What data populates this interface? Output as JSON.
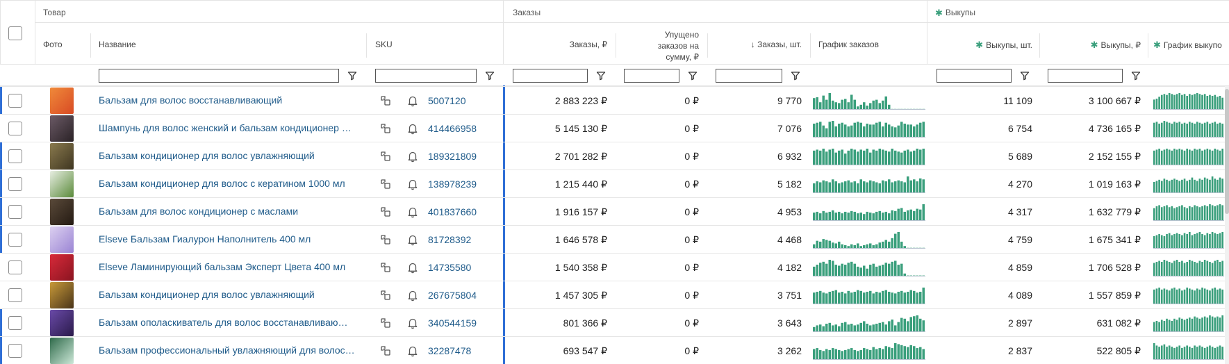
{
  "groups": {
    "product": "Товар",
    "orders": "Заказы",
    "buyouts": "Выкупы"
  },
  "columns": {
    "photo": "Фото",
    "name": "Название",
    "sku": "SKU",
    "orders_rub": "Заказы, ₽",
    "lost_l1": "Упущено",
    "lost_l2": "заказов на",
    "lost_l3": "сумму, ₽",
    "orders_pcs": "↓ Заказы, шт.",
    "orders_chart": "График заказов",
    "buyouts_pcs": "Выкупы, шт.",
    "buyouts_rub": "Выкупы, ₽",
    "buyouts_chart": "График выкупо"
  },
  "colors": {
    "accent": "#2f6fd6",
    "bars": "#3a9f7c",
    "link": "#1f5b8a"
  },
  "rows": [
    {
      "name": "Бальзам для волос восстанавливающий",
      "sku": "5007120",
      "orders_rub": "2 883 223 ₽",
      "lost": "0 ₽",
      "orders_pcs": "9 770",
      "buyouts_pcs": "11 109",
      "buyouts_rub": "3 100 667 ₽",
      "accent": true,
      "thumb": [
        "#f08a3a",
        "#d84a24"
      ],
      "orders_series": [
        14,
        15,
        9,
        17,
        12,
        20,
        11,
        9,
        8,
        12,
        13,
        9,
        18,
        12,
        4,
        6,
        9,
        5,
        8,
        11,
        12,
        8,
        11,
        16,
        6,
        1,
        1,
        1,
        1,
        1,
        1,
        1,
        1,
        1,
        1,
        1
      ],
      "buyouts_series": [
        11,
        12,
        14,
        16,
        17,
        16,
        18,
        17,
        16,
        17,
        18,
        16,
        17,
        15,
        17,
        16,
        17,
        18,
        17,
        16,
        17,
        15,
        16,
        15,
        16,
        14,
        15,
        13
      ]
    },
    {
      "name": "Шампунь для волос женский и бальзам кондиционер …",
      "sku": "414466958",
      "orders_rub": "5 145 130 ₽",
      "lost": "0 ₽",
      "orders_pcs": "7 076",
      "buyouts_pcs": "6 754",
      "buyouts_rub": "4 736 165 ₽",
      "accent": false,
      "thumb": [
        "#6b5a66",
        "#2a2226"
      ],
      "orders_series": [
        15,
        16,
        17,
        13,
        10,
        17,
        18,
        12,
        15,
        16,
        14,
        12,
        13,
        16,
        17,
        16,
        12,
        15,
        14,
        14,
        16,
        17,
        12,
        16,
        14,
        12,
        11,
        13,
        17,
        15,
        14,
        14,
        12,
        14,
        16,
        17
      ],
      "buyouts_series": [
        16,
        17,
        15,
        16,
        18,
        17,
        16,
        15,
        17,
        16,
        17,
        15,
        16,
        15,
        17,
        16,
        15,
        17,
        16,
        15,
        16,
        17,
        15,
        16,
        17,
        15,
        16,
        15
      ]
    },
    {
      "name": "Бальзам кондиционер для волос увлажняющий",
      "sku": "189321809",
      "orders_rub": "2 701 282 ₽",
      "lost": "0 ₽",
      "orders_pcs": "6 932",
      "buyouts_pcs": "5 689",
      "buyouts_rub": "2 152 155 ₽",
      "accent": true,
      "thumb": [
        "#8a7a4e",
        "#3e3520"
      ],
      "orders_series": [
        15,
        16,
        15,
        17,
        14,
        16,
        17,
        13,
        15,
        16,
        12,
        15,
        17,
        16,
        14,
        16,
        15,
        17,
        13,
        16,
        15,
        17,
        16,
        15,
        14,
        17,
        15,
        14,
        13,
        15,
        16,
        14,
        15,
        17,
        16,
        17
      ],
      "buyouts_series": [
        15,
        16,
        17,
        15,
        16,
        17,
        16,
        15,
        17,
        16,
        17,
        16,
        15,
        17,
        16,
        15,
        17,
        16,
        17,
        15,
        16,
        17,
        16,
        15,
        17,
        16,
        15,
        17
      ]
    },
    {
      "name": "Бальзам кондиционер для волос с кератином 1000 мл",
      "sku": "138978239",
      "orders_rub": "1 215 440 ₽",
      "lost": "0 ₽",
      "orders_pcs": "5 182",
      "buyouts_pcs": "4 270",
      "buyouts_rub": "1 019 163 ₽",
      "accent": true,
      "thumb": [
        "#e8eee2",
        "#5a8a3a"
      ],
      "orders_series": [
        10,
        12,
        11,
        13,
        12,
        11,
        14,
        12,
        10,
        11,
        12,
        13,
        11,
        12,
        10,
        14,
        12,
        11,
        13,
        12,
        11,
        10,
        13,
        12,
        14,
        11,
        12,
        13,
        12,
        11,
        17,
        13,
        14,
        12,
        15,
        14
      ],
      "buyouts_series": [
        10,
        11,
        12,
        11,
        13,
        12,
        11,
        12,
        13,
        12,
        11,
        12,
        13,
        11,
        12,
        14,
        12,
        11,
        13,
        12,
        14,
        13,
        12,
        15,
        13,
        12,
        14,
        13
      ]
    },
    {
      "name": "Бальзам для волос кондиционер с маслами",
      "sku": "401837660",
      "orders_rub": "1 916 157 ₽",
      "lost": "0 ₽",
      "orders_pcs": "4 953",
      "buyouts_pcs": "4 317",
      "buyouts_rub": "1 632 779 ₽",
      "accent": true,
      "thumb": [
        "#5a4a3a",
        "#241a12"
      ],
      "orders_series": [
        11,
        12,
        10,
        13,
        11,
        12,
        14,
        11,
        12,
        10,
        12,
        11,
        13,
        12,
        10,
        11,
        9,
        12,
        11,
        10,
        12,
        13,
        11,
        12,
        10,
        14,
        13,
        16,
        17,
        12,
        14,
        15,
        13,
        16,
        15,
        22
      ],
      "buyouts_series": [
        13,
        15,
        16,
        14,
        15,
        16,
        14,
        15,
        13,
        14,
        15,
        16,
        14,
        13,
        15,
        14,
        16,
        15,
        14,
        15,
        16,
        15,
        17,
        16,
        15,
        16,
        17,
        16
      ]
    },
    {
      "name": "Elseve Бальзам Гиалурон Наполнитель 400 мл",
      "sku": "81728392",
      "orders_rub": "1 646 578 ₽",
      "lost": "0 ₽",
      "orders_pcs": "4 468",
      "buyouts_pcs": "4 759",
      "buyouts_rub": "1 675 341 ₽",
      "accent": true,
      "thumb": [
        "#dcd0f0",
        "#9a84d4"
      ],
      "orders_series": [
        5,
        9,
        8,
        11,
        10,
        9,
        7,
        6,
        8,
        5,
        4,
        3,
        5,
        4,
        6,
        3,
        4,
        5,
        6,
        4,
        5,
        7,
        8,
        10,
        8,
        12,
        17,
        19,
        8,
        3,
        1,
        1,
        1,
        1,
        1,
        1
      ],
      "buyouts_series": [
        12,
        13,
        14,
        13,
        12,
        14,
        15,
        13,
        14,
        15,
        14,
        13,
        15,
        14,
        16,
        13,
        14,
        15,
        16,
        14,
        13,
        15,
        14,
        16,
        15,
        14,
        15,
        16
      ]
    },
    {
      "name": "Elseve Ламинирующий бальзам Эксперт Цвета 400 мл",
      "sku": "14735580",
      "orders_rub": "1 540 358 ₽",
      "lost": "0 ₽",
      "orders_pcs": "4 182",
      "buyouts_pcs": "4 859",
      "buyouts_rub": "1 706 528 ₽",
      "accent": false,
      "thumb": [
        "#d82a3a",
        "#8a1420"
      ],
      "orders_series": [
        10,
        12,
        14,
        15,
        13,
        17,
        16,
        12,
        11,
        13,
        12,
        14,
        15,
        13,
        10,
        9,
        11,
        8,
        12,
        13,
        10,
        11,
        12,
        14,
        13,
        15,
        16,
        12,
        13,
        3,
        1,
        1,
        1,
        1,
        1,
        1
      ],
      "buyouts_series": [
        13,
        14,
        15,
        14,
        16,
        15,
        14,
        13,
        15,
        16,
        14,
        15,
        13,
        14,
        16,
        15,
        14,
        13,
        15,
        14,
        16,
        15,
        14,
        13,
        15,
        16,
        14,
        15
      ]
    },
    {
      "name": "Бальзам кондиционер для волос увлажняющий",
      "sku": "267675804",
      "orders_rub": "1 457 305 ₽",
      "lost": "0 ₽",
      "orders_pcs": "3 751",
      "buyouts_pcs": "4 089",
      "buyouts_rub": "1 557 859 ₽",
      "accent": false,
      "thumb": [
        "#c89a3a",
        "#4a3418"
      ],
      "orders_series": [
        14,
        15,
        16,
        14,
        13,
        15,
        16,
        17,
        14,
        15,
        13,
        16,
        14,
        15,
        17,
        16,
        14,
        15,
        16,
        13,
        15,
        14,
        16,
        17,
        15,
        14,
        13,
        15,
        16,
        14,
        15,
        17,
        16,
        14,
        15,
        20
      ],
      "buyouts_series": [
        15,
        16,
        17,
        15,
        16,
        15,
        14,
        16,
        17,
        15,
        16,
        14,
        15,
        17,
        16,
        15,
        14,
        16,
        15,
        17,
        16,
        15,
        14,
        16,
        17,
        15,
        16,
        15
      ]
    },
    {
      "name": "Бальзам ополаскиватель для волос восстанавливаю…",
      "sku": "340544159",
      "orders_rub": "801 366 ₽",
      "lost": "0 ₽",
      "orders_pcs": "3 643",
      "buyouts_pcs": "2 897",
      "buyouts_rub": "631 082 ₽",
      "accent": true,
      "thumb": [
        "#6a4aa8",
        "#2a1a4a"
      ],
      "orders_series": [
        6,
        8,
        9,
        7,
        10,
        11,
        8,
        9,
        7,
        11,
        12,
        9,
        10,
        8,
        9,
        11,
        13,
        10,
        8,
        9,
        10,
        11,
        12,
        9,
        13,
        15,
        8,
        12,
        17,
        16,
        13,
        18,
        19,
        20,
        16,
        14
      ],
      "buyouts_series": [
        9,
        10,
        9,
        11,
        10,
        12,
        11,
        10,
        12,
        11,
        13,
        12,
        11,
        12,
        13,
        12,
        14,
        13,
        12,
        13,
        14,
        13,
        15,
        14,
        13,
        14,
        13,
        15
      ]
    },
    {
      "name": "Бальзам профессиональный увлажняющий для волос…",
      "sku": "32287478",
      "orders_rub": "693 547 ₽",
      "lost": "0 ₽",
      "orders_pcs": "3 262",
      "buyouts_pcs": "2 837",
      "buyouts_rub": "522 805 ₽",
      "accent": true,
      "thumb": [
        "#2f6a4a",
        "#cce8d8"
      ],
      "orders_series": [
        11,
        12,
        10,
        9,
        11,
        10,
        12,
        11,
        10,
        9,
        10,
        11,
        12,
        10,
        9,
        10,
        12,
        11,
        10,
        13,
        11,
        12,
        11,
        14,
        13,
        12,
        17,
        16,
        15,
        14,
        13,
        15,
        14,
        12,
        13,
        11
      ],
      "buyouts_series": [
        14,
        12,
        11,
        12,
        13,
        11,
        12,
        11,
        10,
        11,
        12,
        10,
        11,
        12,
        11,
        10,
        12,
        11,
        12,
        11,
        10,
        11,
        12,
        11,
        10,
        11,
        12,
        11
      ]
    }
  ]
}
